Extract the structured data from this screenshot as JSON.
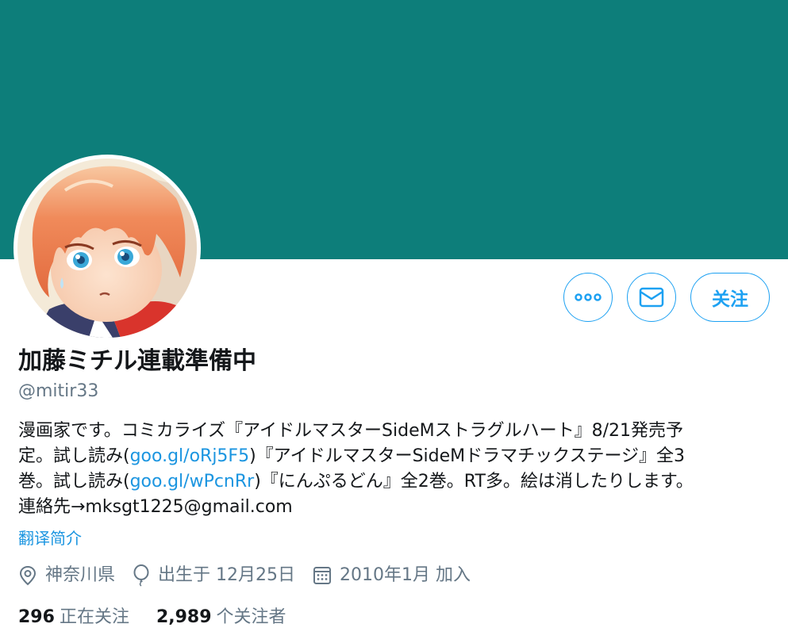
{
  "colors": {
    "banner": "#0d7e7a",
    "accent": "#1da1f2",
    "secondary_text": "#657786"
  },
  "profile": {
    "display_name": "加藤ミチル連載準備中",
    "handle": "@mitir33",
    "bio": {
      "line1": "漫画家です。コミカライズ『アイドルマスターSideMストラグルハート』8/21発売予",
      "line2_a": "定。試し読み(",
      "line2_link": "goo.gl/oRj5F5",
      "line2_b": ")『アイドルマスターSideMドラマチックステージ』全3",
      "line3_a": "巻。試し読み(",
      "line3_link": "goo.gl/wPcnRr",
      "line3_b": ")『にんぷるどん』全2巻。RT多。絵は消したりします。",
      "line4": "連絡先→mksgt1225@gmail.com"
    },
    "translate_label": "翻译简介",
    "location": "神奈川県",
    "birthday": "出生于 12月25日",
    "joined": "2010年1月 加入",
    "following_count": "296",
    "following_label": "正在关注",
    "followers_count": "2,989",
    "followers_label": "个关注者"
  },
  "actions": {
    "more_icon": "more-icon",
    "message_icon": "envelope-icon",
    "follow_label": "关注"
  }
}
